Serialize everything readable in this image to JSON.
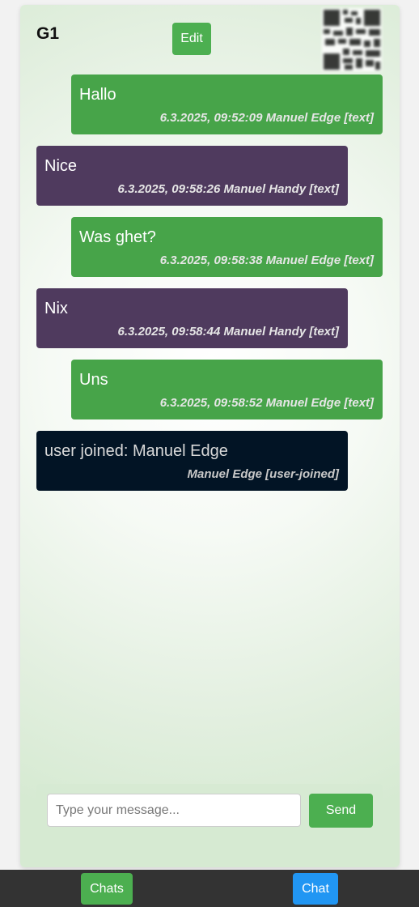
{
  "header": {
    "title": "G1",
    "edit_label": "Edit",
    "qr_icon": "qr-code-icon"
  },
  "messages": [
    {
      "kind": "own",
      "text": "Hallo",
      "meta": "6.3.2025, 09:52:09 Manuel Edge [text]"
    },
    {
      "kind": "other",
      "text": "Nice",
      "meta": "6.3.2025, 09:58:26 Manuel Handy [text]"
    },
    {
      "kind": "own",
      "text": "Was ghet?",
      "meta": "6.3.2025, 09:58:38 Manuel Edge [text]"
    },
    {
      "kind": "other",
      "text": "Nix",
      "meta": "6.3.2025, 09:58:44 Manuel Handy [text]"
    },
    {
      "kind": "own",
      "text": "Uns",
      "meta": "6.3.2025, 09:58:52 Manuel Edge [text]"
    },
    {
      "kind": "system",
      "text": "user joined: Manuel Edge",
      "meta": "Manuel Edge [user-joined]"
    }
  ],
  "composer": {
    "placeholder": "Type your message...",
    "value": "",
    "send_label": "Send"
  },
  "nav": {
    "chats_label": "Chats",
    "chat_label": "Chat"
  },
  "colors": {
    "own_bubble": "#47a449",
    "other_bubble": "#4f3a5e",
    "system_bubble": "#021425",
    "accent_green": "#4caf50",
    "accent_blue": "#2196f3",
    "nav_bar": "#333333"
  }
}
